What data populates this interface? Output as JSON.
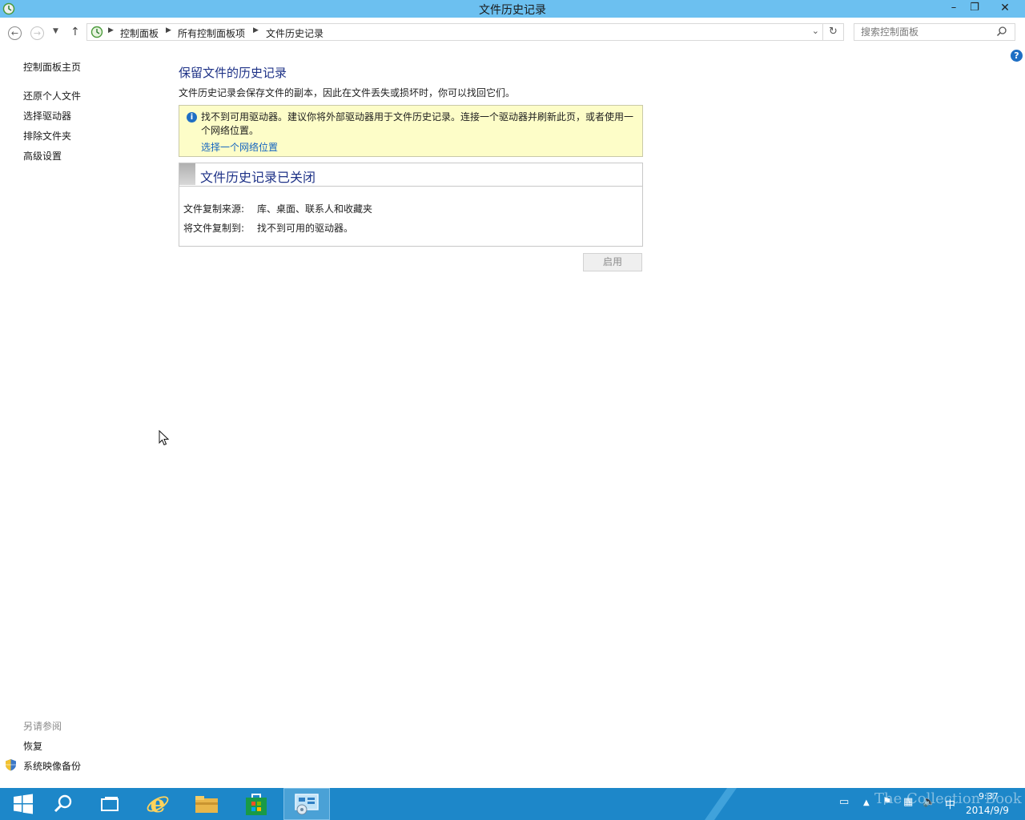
{
  "window": {
    "title": "文件历史记录"
  },
  "titlebar": {
    "minimize": "–",
    "restore": "❐",
    "close": "✕"
  },
  "breadcrumb": [
    "控制面板",
    "所有控制面板项",
    "文件历史记录"
  ],
  "search": {
    "placeholder": "搜索控制面板"
  },
  "help": {
    "label": "?"
  },
  "leftnav": {
    "items": [
      "控制面板主页",
      "还原个人文件",
      "选择驱动器",
      "排除文件夹",
      "高级设置"
    ]
  },
  "seealso": {
    "heading": "另请参阅",
    "items": [
      "恢复",
      "系统映像备份"
    ]
  },
  "main": {
    "title": "保留文件的历史记录",
    "description": "文件历史记录会保存文件的副本，因此在文件丢失或损坏时，你可以找回它们。",
    "info": {
      "icon": "i",
      "text": "找不到可用驱动器。建议你将外部驱动器用于文件历史记录。连接一个驱动器并刷新此页，或者使用一个网络位置。",
      "link": "选择一个网络位置"
    },
    "status": {
      "title": "文件历史记录已关闭",
      "rows": [
        {
          "label": "文件复制来源:",
          "value": "库、桌面、联系人和收藏夹"
        },
        {
          "label": "将文件复制到:",
          "value": "找不到可用的驱动器。"
        }
      ]
    },
    "enable_button": "启用"
  },
  "taskbar": {
    "items": [
      "start-icon",
      "search-icon",
      "task-view-icon",
      "internet-explorer-icon",
      "file-explorer-icon",
      "store-icon",
      "control-panel-icon"
    ],
    "tray_ime": "中",
    "clock_time": "9:37",
    "clock_date": "2014/9/9",
    "watermark": "The Collection Book"
  },
  "colors": {
    "titlebar": "#6cc0f0",
    "taskbar": "#1d87c9",
    "heading": "#1e3287",
    "link": "#1565c0",
    "infobar": "#fdfdc8"
  }
}
